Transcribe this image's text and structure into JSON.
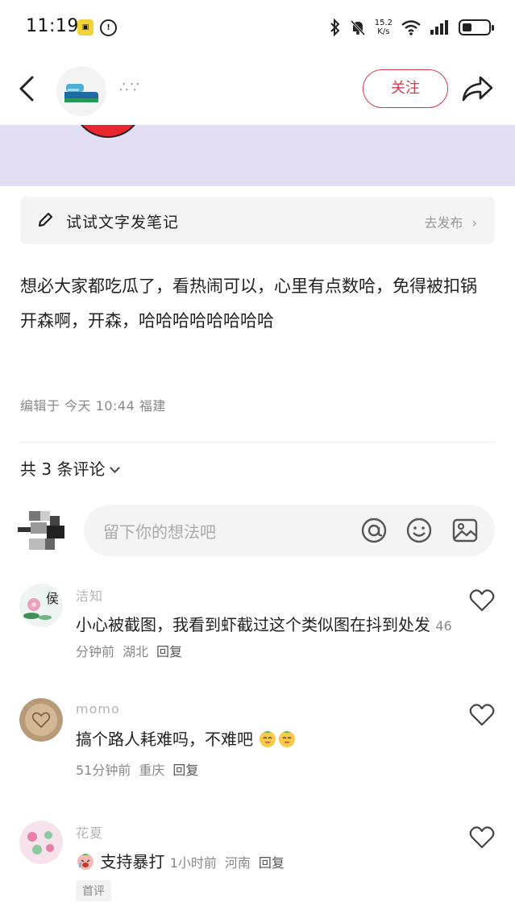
{
  "status_bar": {
    "time": "11:19",
    "net_speed_value": "15.2",
    "net_speed_unit": "K/s",
    "battery_level": 0.35
  },
  "nav": {
    "author_name": "∴∵",
    "follow_label": "关注"
  },
  "try_bar": {
    "label": "试试文字发笔记",
    "publish_label": "去发布"
  },
  "post": {
    "paragraphs": [
      "想必大家都吃瓜了，看热闹可以，心里有点数哈，免得被扣锅",
      "开森啊，开森，哈哈哈哈哈哈哈哈"
    ],
    "edit_meta": "编辑于 今天 10:44 福建"
  },
  "comments_section": {
    "header": "共 3 条评论",
    "input_placeholder": "留下你的想法吧"
  },
  "comments": [
    {
      "name": "洁知",
      "text": "小心被截图，我看到虾截过这个类似图在抖到处发",
      "time": "46分钟前",
      "location": "湖北",
      "reply": "回复"
    },
    {
      "name": "momo",
      "text": "搞个路人耗难吗，不难吧",
      "time": "51分钟前",
      "location": "重庆",
      "reply": "回复"
    },
    {
      "name": "花夏",
      "text": "支持暴打",
      "time": "1小时前",
      "location": "河南",
      "reply": "回复",
      "badge": "首评"
    }
  ]
}
